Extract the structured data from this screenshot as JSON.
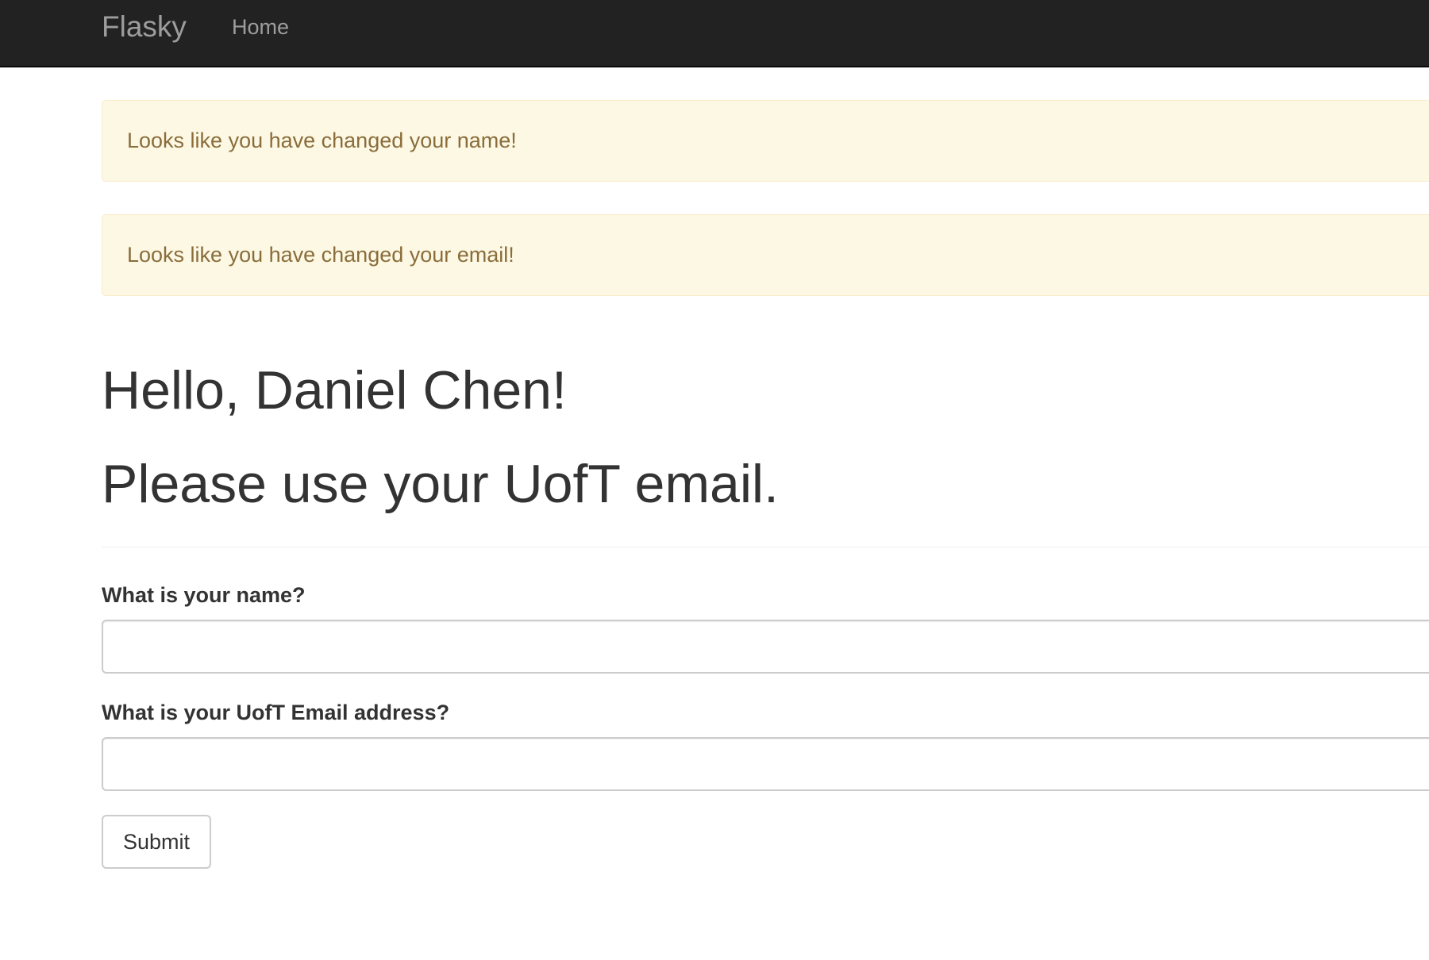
{
  "navbar": {
    "brand": "Flasky",
    "links": [
      {
        "label": "Home"
      }
    ]
  },
  "alerts": [
    {
      "message": "Looks like you have changed your name!"
    },
    {
      "message": "Looks like you have changed your email!"
    }
  ],
  "page_header": {
    "greeting": "Hello, Daniel Chen!",
    "note": "Please use your UofT email."
  },
  "form": {
    "name_label": "What is your name?",
    "name_value": "",
    "email_label": "What is your UofT Email address?",
    "email_value": "",
    "submit_label": "Submit"
  },
  "colors": {
    "navbar_bg": "#222222",
    "navbar_text": "#9d9d9d",
    "alert_bg": "#fcf8e3",
    "alert_border": "#faebcc",
    "alert_text": "#8a6d3b",
    "body_text": "#333333"
  }
}
